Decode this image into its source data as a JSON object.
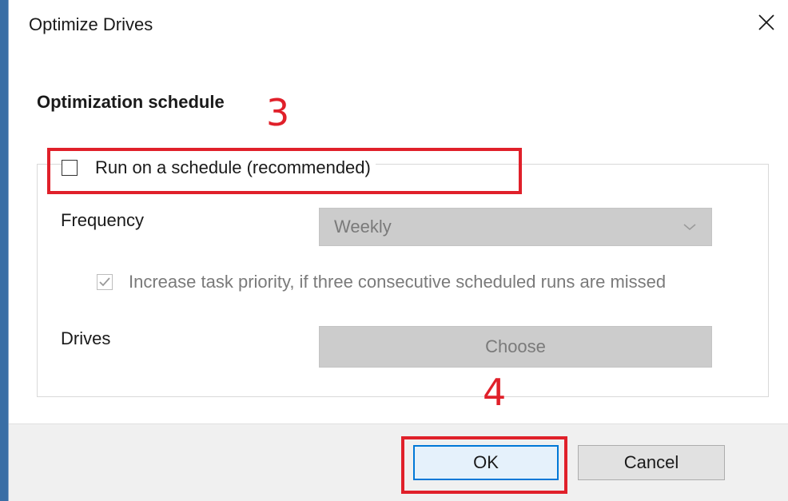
{
  "dialog": {
    "title": "Optimize Drives",
    "close_label": "×"
  },
  "schedule": {
    "section_title": "Optimization schedule",
    "run_on_schedule": {
      "label": "Run on a schedule (recommended)",
      "checked": false
    },
    "frequency": {
      "label": "Frequency",
      "selected": "Weekly"
    },
    "increase_priority": {
      "label": "Increase task priority, if three consecutive scheduled runs are missed",
      "checked": true,
      "disabled": true
    },
    "drives": {
      "label": "Drives",
      "button_label": "Choose"
    }
  },
  "footer": {
    "ok_label": "OK",
    "cancel_label": "Cancel"
  },
  "annotations": {
    "step_3": "3",
    "step_4": "4",
    "color": "#e0202a"
  },
  "colors": {
    "accent": "#0078d7",
    "disabled_fill": "#cccccc",
    "disabled_text": "#7a7a7a"
  },
  "icons": [
    "close-icon",
    "checkbox-icon",
    "check-icon",
    "chevron-down-icon"
  ]
}
